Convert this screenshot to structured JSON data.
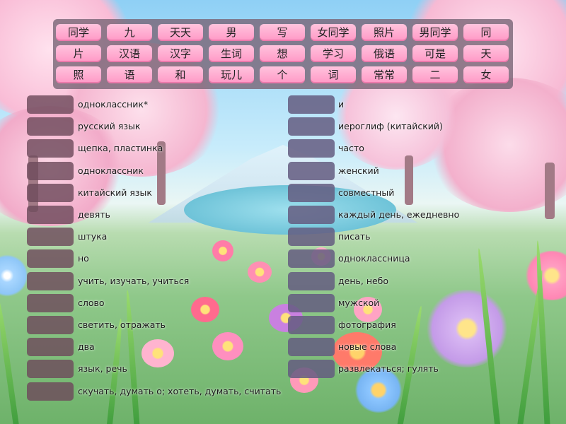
{
  "word_bank": [
    [
      "同学",
      "九",
      "天天",
      "男",
      "写",
      "女同学",
      "照片",
      "男同学",
      "同"
    ],
    [
      "片",
      "汉语",
      "汉字",
      "生词",
      "想",
      "学习",
      "俄语",
      "可是",
      "天"
    ],
    [
      "照",
      "语",
      "和",
      "玩儿",
      "个",
      "词",
      "常常",
      "二",
      "女"
    ]
  ],
  "clues_left": [
    "одноклассник*",
    "русский язык",
    "щепка, пластинка",
    "одноклассник",
    "китайский язык",
    "девять",
    "штука",
    "но",
    "учить, изучать, учиться",
    "слово",
    "светить, отражать",
    "два",
    "язык, речь",
    "скучать, думать о; хотеть, думать, считать"
  ],
  "clues_right": [
    "и",
    "иероглиф (китайский)",
    "часто",
    "женский",
    "совместный",
    "каждый день, ежедневно",
    "писать",
    "одноклассница",
    "день, небо",
    "мужской",
    "фотография",
    "новые слова",
    "развлекаться; гулять"
  ],
  "colors": {
    "tile": "#ffa8cf",
    "bank_bg": "#7a6678",
    "slot_left": "#6e4a5c",
    "slot_right": "#645c80"
  }
}
